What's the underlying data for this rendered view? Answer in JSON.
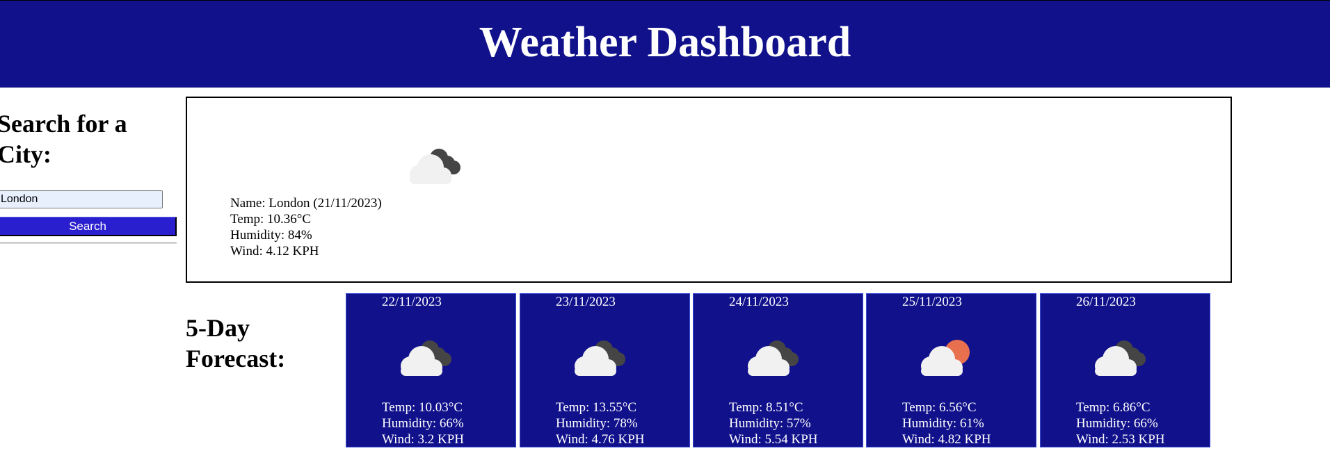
{
  "header": {
    "title": "Weather Dashboard"
  },
  "sidebar": {
    "heading": "Search for a City:",
    "input_value": "London",
    "search_label": "Search"
  },
  "current": {
    "icon": "cloudy-icon",
    "name": "Name: London (21/11/2023)",
    "temp": "Temp: 10.36°C",
    "humidity": "Humidity: 84%",
    "wind": "Wind: 4.12 KPH"
  },
  "forecast": {
    "title": "5-Day Forecast:",
    "days": [
      {
        "date": "22/11/2023",
        "icon": "cloudy-icon",
        "temp": "Temp: 10.03°C",
        "humidity": "Humidity: 66%",
        "wind": "Wind: 3.2 KPH"
      },
      {
        "date": "23/11/2023",
        "icon": "cloudy-icon",
        "temp": "Temp: 13.55°C",
        "humidity": "Humidity: 78%",
        "wind": "Wind: 4.76 KPH"
      },
      {
        "date": "24/11/2023",
        "icon": "cloudy-icon",
        "temp": "Temp: 8.51°C",
        "humidity": "Humidity: 57%",
        "wind": "Wind: 5.54 KPH"
      },
      {
        "date": "25/11/2023",
        "icon": "partly-cloudy-icon",
        "temp": "Temp: 6.56°C",
        "humidity": "Humidity: 61%",
        "wind": "Wind: 4.82 KPH"
      },
      {
        "date": "26/11/2023",
        "icon": "cloudy-icon",
        "temp": "Temp: 6.86°C",
        "humidity": "Humidity: 66%",
        "wind": "Wind: 2.53 KPH"
      }
    ]
  },
  "colors": {
    "brand": "#11128b",
    "button": "#2a1fcf",
    "sun": "#e8704f",
    "dark_cloud": "#454545",
    "light_cloud": "#f1f1f1"
  }
}
